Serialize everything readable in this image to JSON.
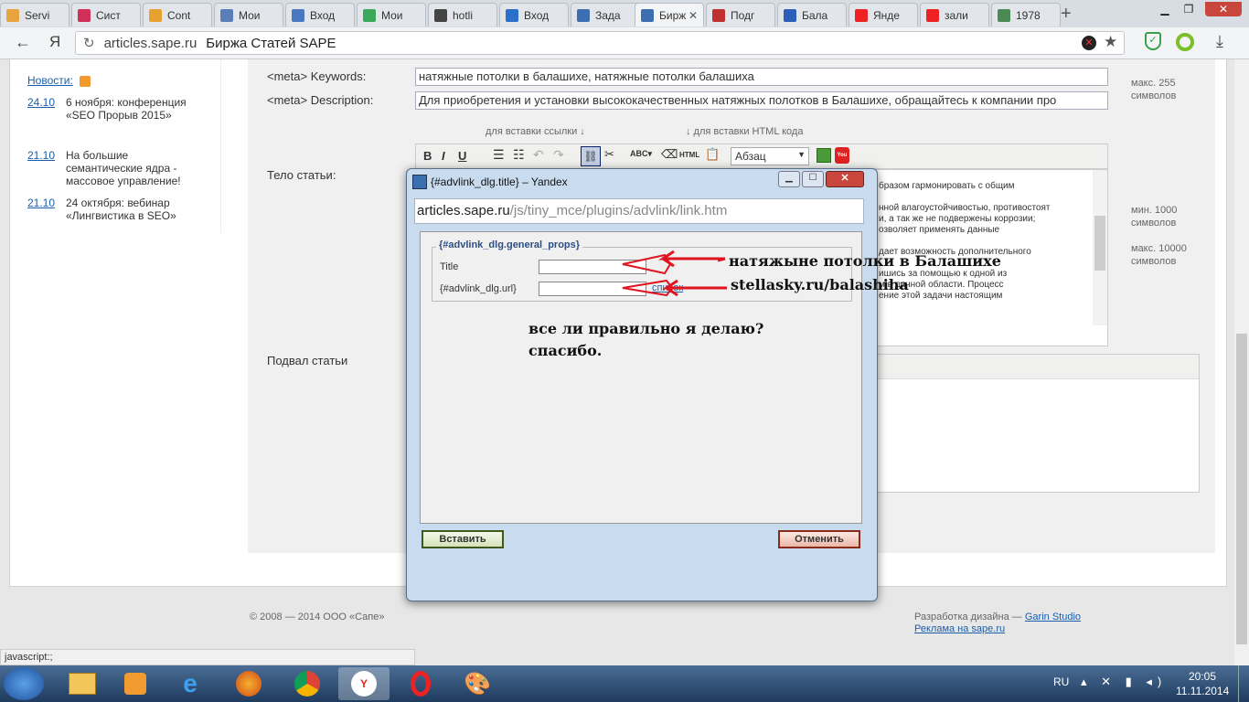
{
  "browser": {
    "tabs": [
      {
        "label": "Servi",
        "icon": "sape-icon",
        "color": "#e8a440"
      },
      {
        "label": "Сист",
        "icon": "circle-icon",
        "color": "#d0305a"
      },
      {
        "label": "Cont",
        "icon": "box-icon",
        "color": "#e8a030"
      },
      {
        "label": "Мои",
        "icon": "page-icon",
        "color": "#5a7fb8"
      },
      {
        "label": "Вход",
        "icon": "mail-icon",
        "color": "#4a78c0"
      },
      {
        "label": "Мои",
        "icon": "doc-icon",
        "color": "#39a85b"
      },
      {
        "label": "hotli",
        "icon": "github-icon",
        "color": "#444"
      },
      {
        "label": "Вход",
        "icon": "at-icon",
        "color": "#2a6fc9"
      },
      {
        "label": "Зада",
        "icon": "grid-icon",
        "color": "#3b6fb0"
      },
      {
        "label": "Бирж",
        "icon": "grid-icon",
        "color": "#3b6fb0",
        "active": true
      },
      {
        "label": "Подг",
        "icon": "bars-icon",
        "color": "#c03030"
      },
      {
        "label": "Бала",
        "icon": "butterfly-icon",
        "color": "#2a60b8"
      },
      {
        "label": "Янде",
        "icon": "yandex-icon",
        "color": "#e22"
      },
      {
        "label": "зали",
        "icon": "yandex-icon",
        "color": "#e22"
      },
      {
        "label": "1978",
        "icon": "photo-icon",
        "color": "#4b8a55"
      }
    ],
    "url_domain": "articles.sape.ru",
    "url_title": "Биржа Статей SAPE",
    "yandex_letter": "Я",
    "status_url": "javascript:;"
  },
  "sidebar": {
    "news_label": "Новости:",
    "items": [
      {
        "date": "24.10",
        "text": "6 ноября: конференция «SEO Прорыв 2015»"
      },
      {
        "date": "21.10",
        "text": "На большие семантические ядра - массовое управление!"
      },
      {
        "date": "21.10",
        "text": "24 октября: вебинар «Лингвистика в SEO»"
      }
    ]
  },
  "form": {
    "keywords_label": "<meta> Keywords:",
    "keywords_value": "натяжные потолки в балашихе,  натяжные потолки балашиха",
    "keywords_hint": "макс. 255 символов",
    "description_label": "<meta> Description:",
    "description_value": "Для приобретения и установки высококачественных натяжных полотков в Балашихе, обращайтесь к компании про",
    "hint_link": "для вставки ссылки ↓",
    "hint_html": "↓ для вставки HTML кода",
    "body_label": "Тело статьи:",
    "format_select": "Абзац",
    "body_hint_min": "мин. 1000 символов",
    "body_hint_max": "макс. 10000 символов",
    "body_text_lines": [
      "бразом гармонировать с общим",
      "",
      "нной влагоустойчивостью, противостоят",
      "и, а так же не подвержены коррозии;",
      "озволяет применять данные",
      "",
      "дает возможность дополнительного",
      "",
      "ишись за помощью к одной из",
      "м в данной области. Процесс",
      "ение этой задачи настоящим"
    ],
    "footer_label": "Подвал статьи"
  },
  "dialog": {
    "title": "{#advlink_dlg.title} – Yandex",
    "url_domain": "articles.sape.ru",
    "url_path": "/js/tiny_mce/plugins/advlink/link.htm",
    "legend": "{#advlink_dlg.general_props}",
    "title_label": "Title",
    "url_label": "{#advlink_dlg.url}",
    "list_link": "список",
    "insert_button": "Вставить",
    "cancel_button": "Отменить"
  },
  "annotations": {
    "title_note": "натяжыне потолки в Балашихе",
    "url_note": "stellasky.ru/balashiha",
    "question_line1": "все ли правильно я делаю?",
    "question_line2": "спасибо."
  },
  "page_footer": {
    "copyright": "© 2008 — 2014 ООО «Сапе»",
    "design_prefix": "Разработка дизайна — ",
    "design_link": "Garin Studio",
    "ad_link": "Реклама на sape.ru"
  },
  "taskbar": {
    "lang": "RU",
    "time": "20:05",
    "date": "11.11.2014"
  }
}
